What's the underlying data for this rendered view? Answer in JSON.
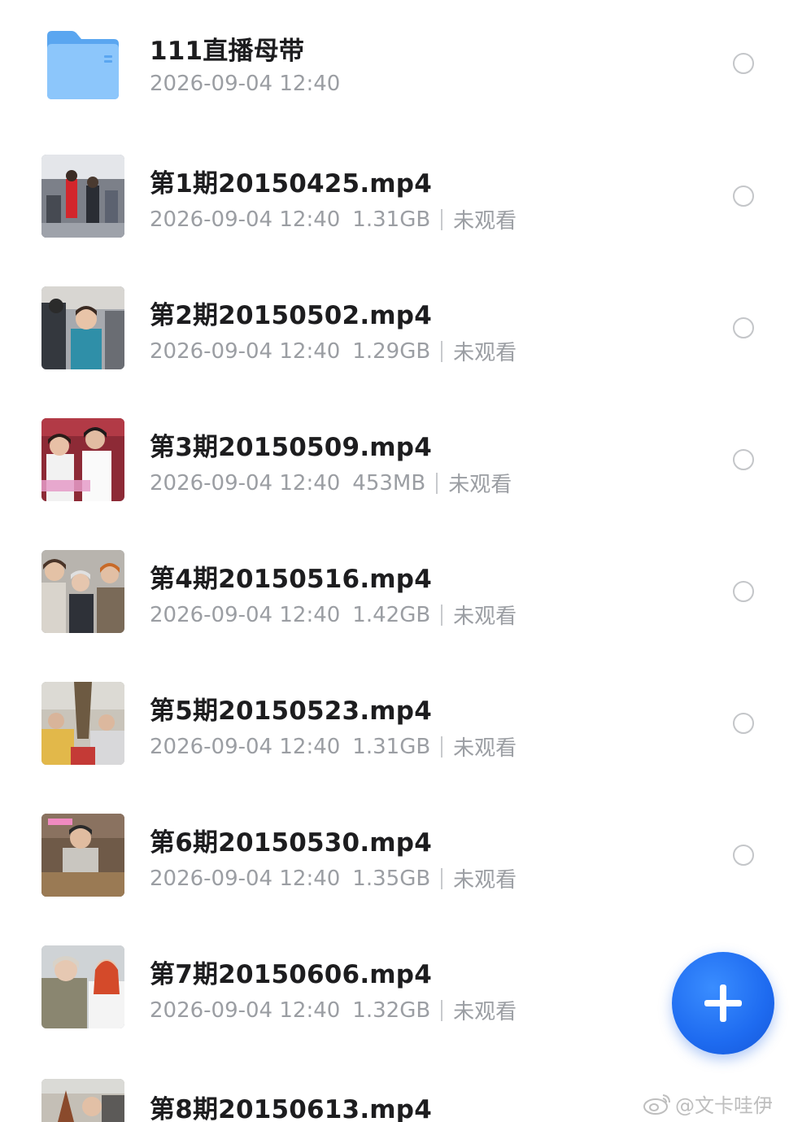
{
  "folder": {
    "name": "111直播母带",
    "date": "2026-09-04 12:40",
    "icon": "folder-icon",
    "color": "#6fb4f5"
  },
  "files": [
    {
      "name": "第1期20150425.mp4",
      "date": "2026-09-04 12:40",
      "size": "1.31GB",
      "status": "未观看"
    },
    {
      "name": "第2期20150502.mp4",
      "date": "2026-09-04 12:40",
      "size": "1.29GB",
      "status": "未观看"
    },
    {
      "name": "第3期20150509.mp4",
      "date": "2026-09-04 12:40",
      "size": "453MB",
      "status": "未观看"
    },
    {
      "name": "第4期20150516.mp4",
      "date": "2026-09-04 12:40",
      "size": "1.42GB",
      "status": "未观看"
    },
    {
      "name": "第5期20150523.mp4",
      "date": "2026-09-04 12:40",
      "size": "1.31GB",
      "status": "未观看"
    },
    {
      "name": "第6期20150530.mp4",
      "date": "2026-09-04 12:40",
      "size": "1.35GB",
      "status": "未观看"
    },
    {
      "name": "第7期20150606.mp4",
      "date": "2026-09-04 12:40",
      "size": "1.32GB",
      "status": "未观看"
    },
    {
      "name": "第8期20150613.mp4"
    }
  ],
  "fab": {
    "icon": "plus-icon",
    "color": "#1e6bf0"
  },
  "watermark": {
    "text": "@文卡哇伊",
    "icon": "weibo-icon"
  }
}
